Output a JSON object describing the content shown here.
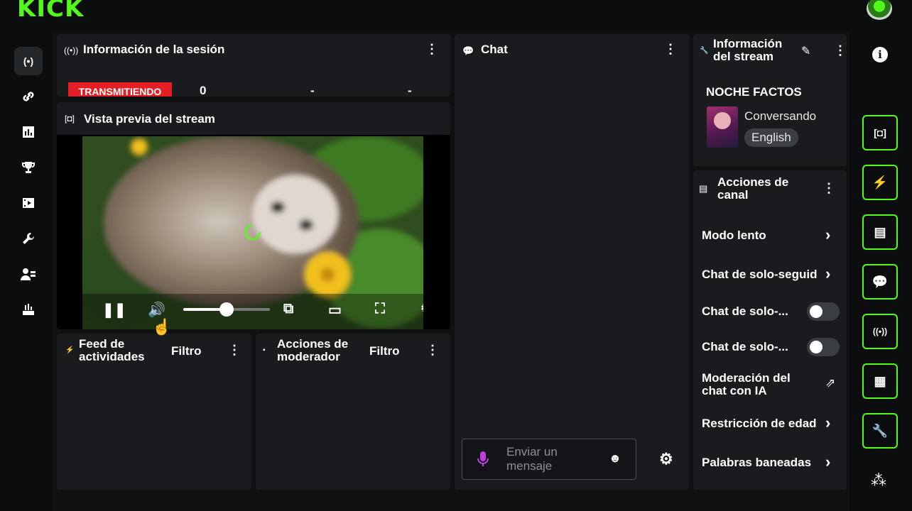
{
  "brand": {
    "logo_text": "KICK"
  },
  "left_nav": [
    {
      "name": "broadcast-icon",
      "glyph": "(•)"
    },
    {
      "name": "link-icon",
      "glyph": "⛓"
    },
    {
      "name": "stats-icon",
      "glyph": "▥"
    },
    {
      "name": "trophy-icon",
      "glyph": "🏆"
    },
    {
      "name": "video-library-icon",
      "glyph": "▣"
    },
    {
      "name": "wrench-icon",
      "glyph": "🔧"
    },
    {
      "name": "users-icon",
      "glyph": "👥"
    },
    {
      "name": "upload-icon",
      "glyph": "⏏"
    }
  ],
  "session": {
    "title": "Información de la sesión",
    "status_badge": "TRANSMITIENDO",
    "viewers": "0",
    "stat_2": "-",
    "stat_3": "-"
  },
  "preview": {
    "title": "Vista previa del stream"
  },
  "feed": {
    "title_line1": "Feed de",
    "title_line2": "actividades",
    "filter": "Filtro"
  },
  "moderator": {
    "title_line1": "Acciones de",
    "title_line2": "moderador",
    "filter": "Filtro"
  },
  "chat": {
    "title": "Chat",
    "input_placeholder_line1": "Enviar un",
    "input_placeholder_line2": "mensaje"
  },
  "stream_info": {
    "title_line1": "Información",
    "title_line2": "del stream",
    "stream_title": "NOCHE FACTOS",
    "category": "Conversando",
    "language": "English"
  },
  "channel_actions": {
    "title_line1": "Acciones de",
    "title_line2": "canal",
    "items": [
      {
        "label": "Modo lento",
        "control": "chevron"
      },
      {
        "label": "Chat de solo-seguid",
        "control": "chevron"
      },
      {
        "label": "Chat de solo-...",
        "control": "toggle"
      },
      {
        "label": "Chat de solo-...",
        "control": "toggle"
      },
      {
        "label_line1": "Moderación del",
        "label_line2": "chat con IA",
        "control": "external"
      },
      {
        "label": "Restricción de edad",
        "control": "chevron"
      },
      {
        "label": "Palabras baneadas",
        "control": "chevron"
      }
    ]
  },
  "right_rail": [
    {
      "name": "info-icon"
    },
    {
      "name": "preview-icon"
    },
    {
      "name": "lightning-icon"
    },
    {
      "name": "notes-icon"
    },
    {
      "name": "chat-bubble-icon"
    },
    {
      "name": "broadcast-icon"
    },
    {
      "name": "channel-actions-icon"
    },
    {
      "name": "wrench-icon"
    },
    {
      "name": "more-icon"
    }
  ],
  "colors": {
    "accent": "#53fc18",
    "live_badge": "#e31e24",
    "panel": "#191b1f",
    "background": "#0f1012"
  },
  "player": {
    "volume_fraction": 0.5
  }
}
